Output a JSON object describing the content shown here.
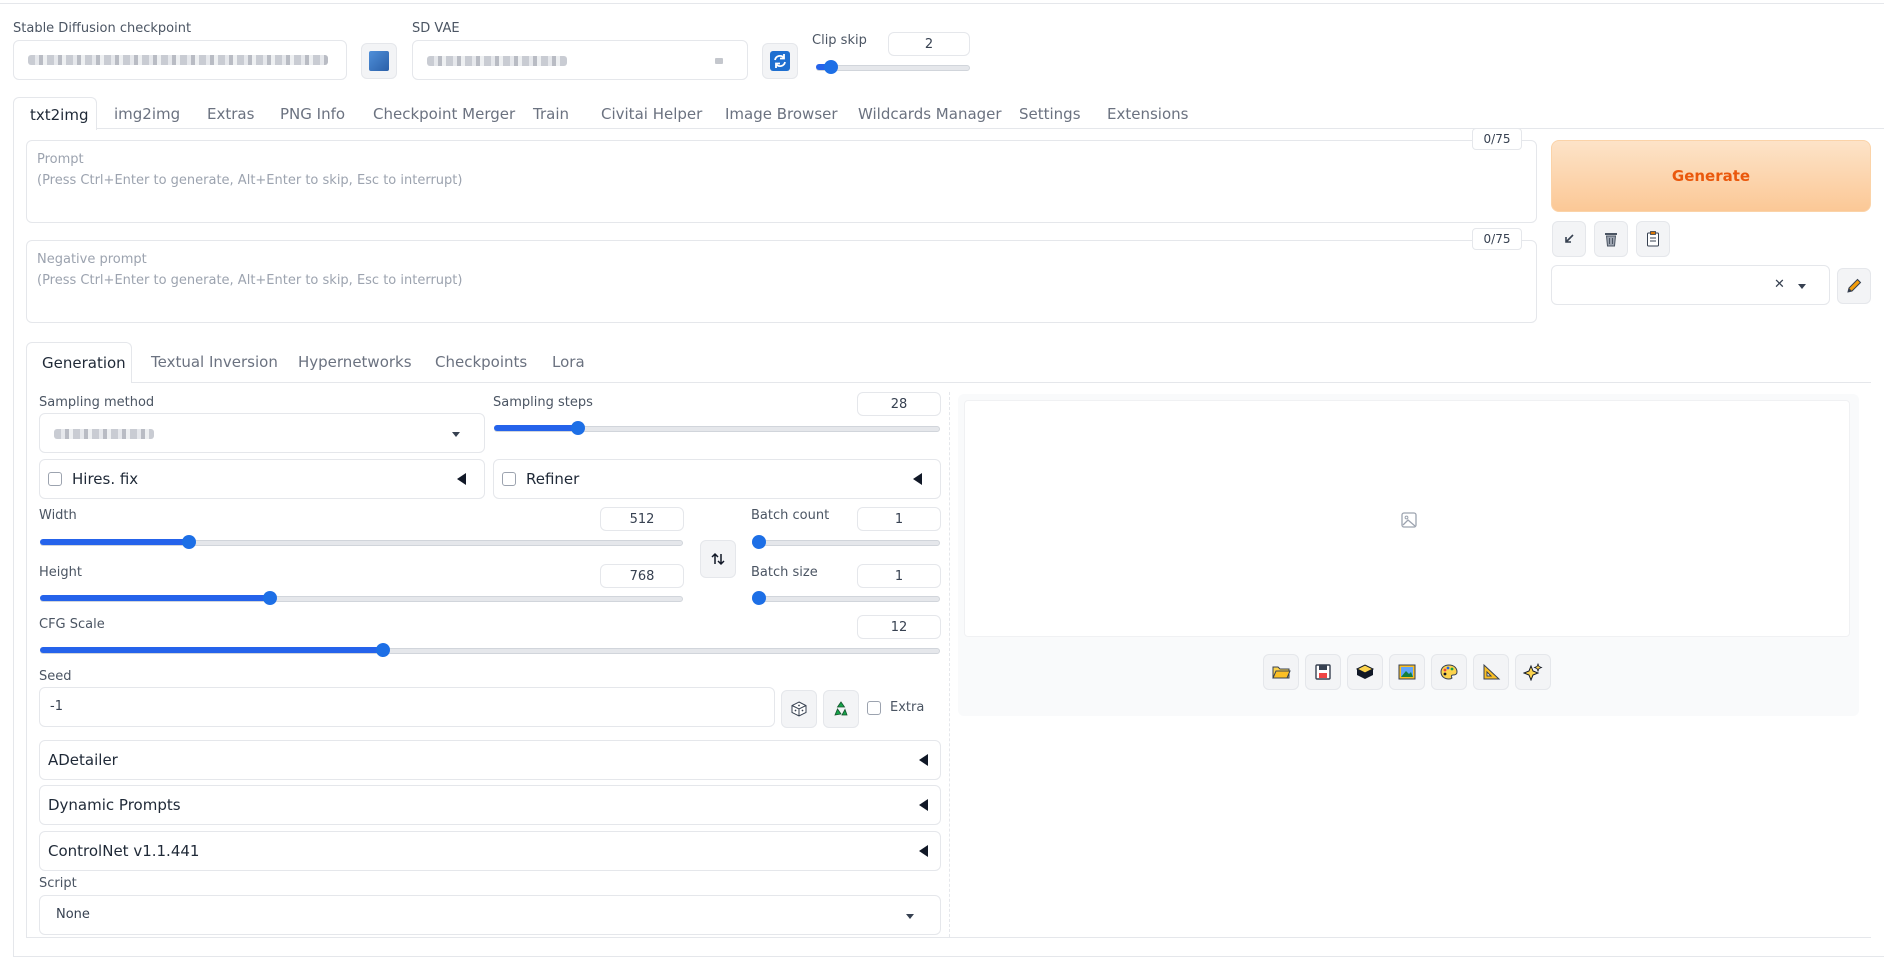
{
  "header": {
    "checkpoint_label": "Stable Diffusion checkpoint",
    "vae_label": "SD VAE",
    "clip_skip_label": "Clip skip",
    "clip_skip_value": "2",
    "clip_skip_level": 0.1
  },
  "tabs": [
    {
      "label": "txt2img"
    },
    {
      "label": "img2img"
    },
    {
      "label": "Extras"
    },
    {
      "label": "PNG Info"
    },
    {
      "label": "Checkpoint Merger"
    },
    {
      "label": "Train"
    },
    {
      "label": "Civitai Helper"
    },
    {
      "label": "Image Browser"
    },
    {
      "label": "Wildcards Manager"
    },
    {
      "label": "Settings"
    },
    {
      "label": "Extensions"
    }
  ],
  "prompt": {
    "label": "Prompt",
    "hint": "(Press Ctrl+Enter to generate, Alt+Enter to skip, Esc to interrupt)",
    "counter": "0/75"
  },
  "negative_prompt": {
    "label": "Negative prompt",
    "hint": "(Press Ctrl+Enter to generate, Alt+Enter to skip, Esc to interrupt)",
    "counter": "0/75"
  },
  "generate_label": "Generate",
  "subtabs": [
    {
      "label": "Generation"
    },
    {
      "label": "Textual Inversion"
    },
    {
      "label": "Hypernetworks"
    },
    {
      "label": "Checkpoints"
    },
    {
      "label": "Lora"
    }
  ],
  "generation": {
    "sampling_method_label": "Sampling method",
    "sampling_steps_label": "Sampling steps",
    "sampling_steps_value": "28",
    "hires_label": "Hires. fix",
    "refiner_label": "Refiner",
    "width_label": "Width",
    "width_value": "512",
    "height_label": "Height",
    "height_value": "768",
    "batch_count_label": "Batch count",
    "batch_count_value": "1",
    "batch_size_label": "Batch size",
    "batch_size_value": "1",
    "cfg_label": "CFG Scale",
    "cfg_value": "12",
    "seed_label": "Seed",
    "seed_value": "-1",
    "extra_label": "Extra",
    "adetailer_label": "ADetailer",
    "dynamic_prompts_label": "Dynamic Prompts",
    "controlnet_label": "ControlNet v1.1.441",
    "script_label": "Script",
    "script_value": "None"
  },
  "colors": {
    "accent": "#1d6fe6",
    "generate_text": "#ea580c"
  }
}
